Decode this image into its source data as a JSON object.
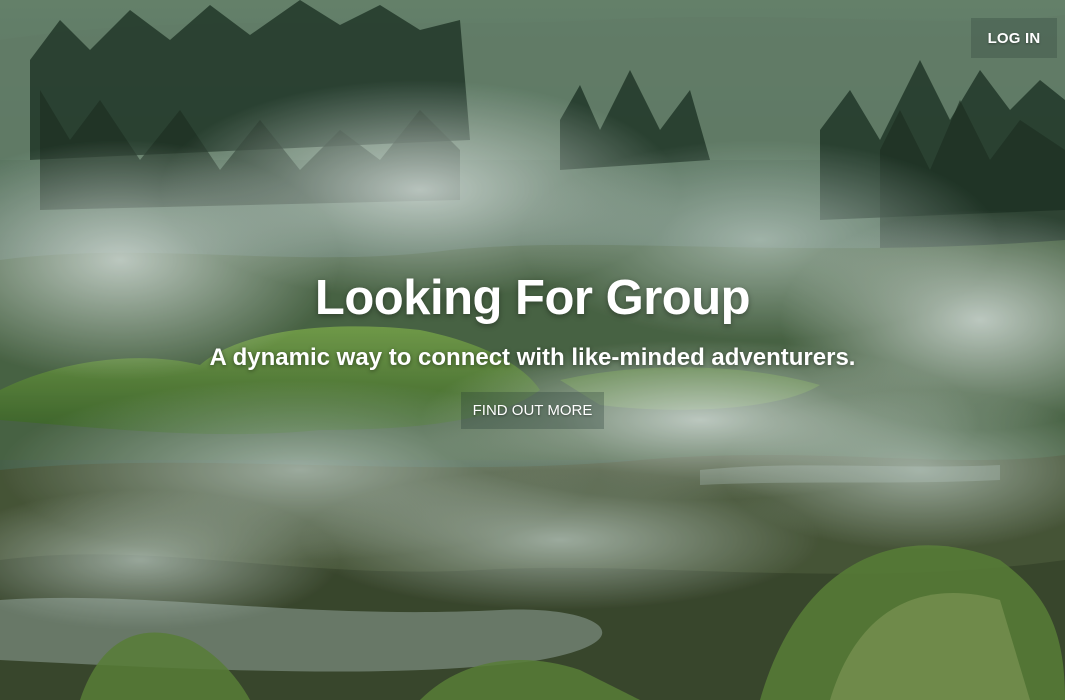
{
  "nav": {
    "login_label": "LOG IN"
  },
  "hero": {
    "title": "Looking For Group",
    "subtitle": "A dynamic way to connect with like-minded adventurers.",
    "cta_label": "FIND OUT MORE"
  },
  "background": {
    "description_icon": "misty-landscape-photo",
    "colors": {
      "sky_mist": "#8fa89a",
      "trees": "#2f4a38",
      "moss": "#5b8a3a",
      "ground": "#4d5e3e",
      "steam": "#e6f0ec"
    }
  }
}
